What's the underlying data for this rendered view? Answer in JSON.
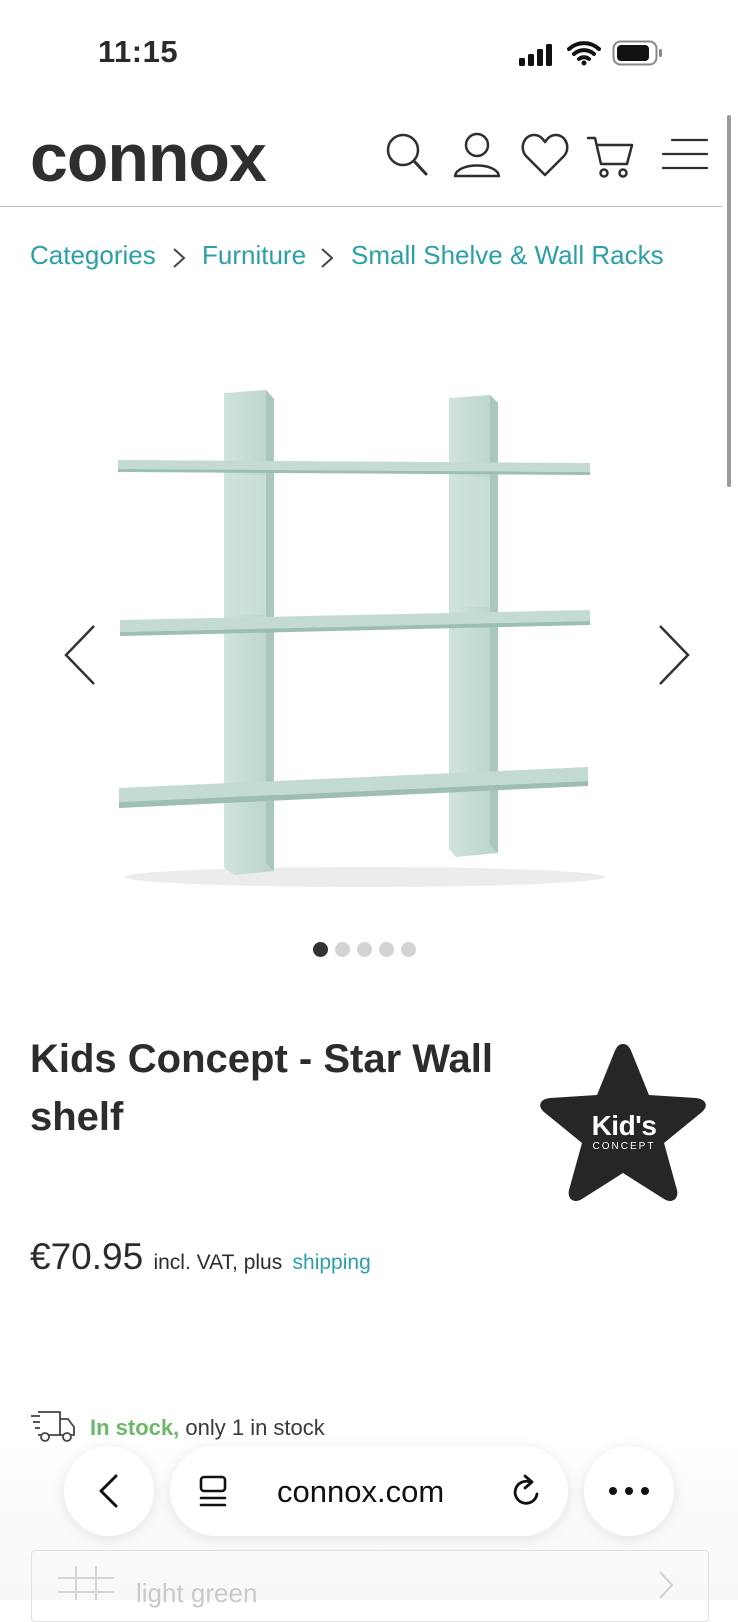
{
  "status_bar": {
    "time": "11:15"
  },
  "header": {
    "logo": "connox",
    "icons": [
      "search-icon",
      "account-icon",
      "wishlist-heart-icon",
      "cart-icon",
      "menu-icon"
    ]
  },
  "breadcrumb": {
    "items": [
      "Categories",
      "Furniture",
      "Small Shelve & Wall Racks"
    ]
  },
  "gallery": {
    "image_count": 5,
    "active_index": 0,
    "shelf_color": "#c9e0d8"
  },
  "product": {
    "title": "Kids Concept - Star Wall shelf",
    "brand_logo_text": "Kid's CONCEPT",
    "price": "€70.95",
    "vat_text": "incl. VAT, plus",
    "shipping_link": "shipping",
    "stock_status": "In stock,",
    "stock_note": "only 1 in stock",
    "variant": "light green"
  },
  "browser": {
    "url": "connox.com"
  },
  "colors": {
    "accent": "#2aa0a8",
    "in_stock": "#6cb86a",
    "text": "#2c2c2c"
  }
}
